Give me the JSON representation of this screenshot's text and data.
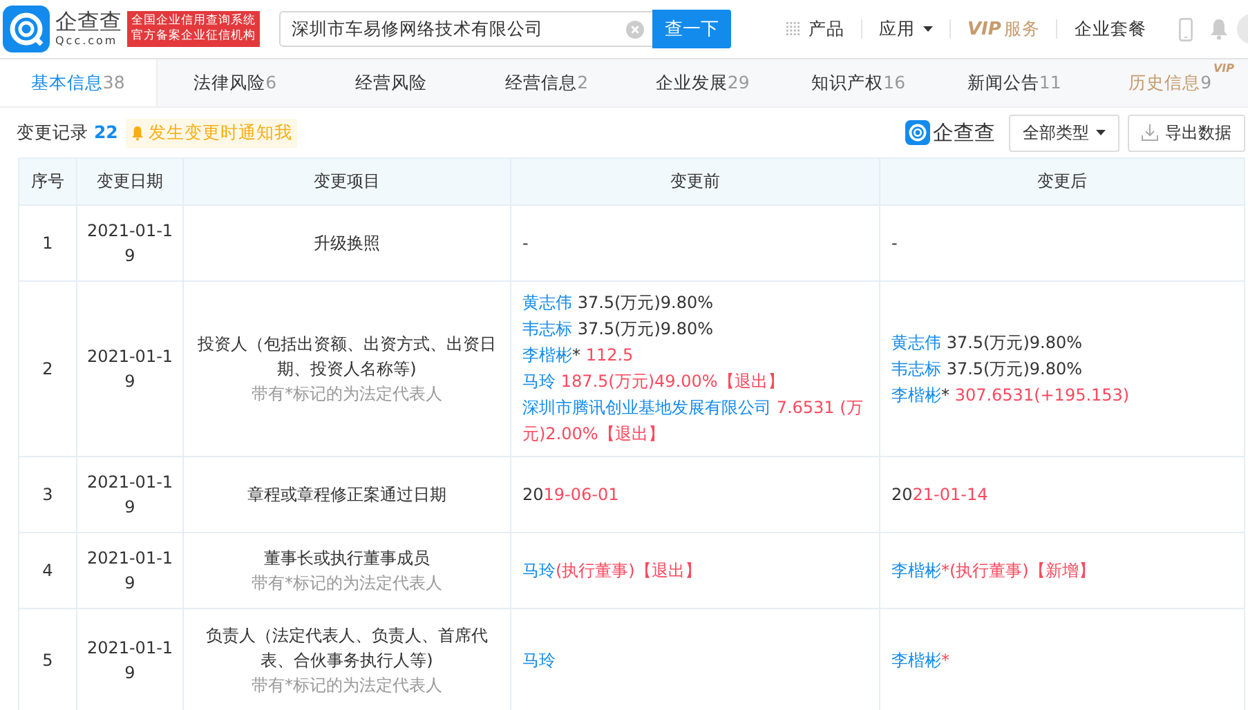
{
  "header": {
    "logo_name": "企查查",
    "logo_domain": "Qcc.com",
    "badge_lines": [
      "全国企业信用查询系统",
      "官方备案企业征信机构"
    ],
    "search": {
      "value": "深圳市车易修网络技术有限公司"
    },
    "search_button": "查一下",
    "nav": [
      {
        "kind": "grid",
        "label": "产品"
      },
      {
        "kind": "dropdown",
        "label": "应用"
      },
      {
        "kind": "vip",
        "label": "服务",
        "mark": "VIP"
      },
      {
        "kind": "plain",
        "label": "企业套餐"
      }
    ]
  },
  "tabs": [
    {
      "label": "基本信息",
      "count": "38",
      "selected": true,
      "kind": "normal"
    },
    {
      "label": "法律风险",
      "count": "6",
      "selected": false,
      "kind": "normal"
    },
    {
      "label": "经营风险",
      "selected": false,
      "kind": "normal"
    },
    {
      "label": "经营信息",
      "count": "2",
      "selected": false,
      "kind": "normal"
    },
    {
      "label": "企业发展",
      "count": "29",
      "selected": false,
      "kind": "normal"
    },
    {
      "label": "知识产权",
      "count": "16",
      "selected": false,
      "kind": "normal"
    },
    {
      "label": "新闻公告",
      "count": "11",
      "selected": false,
      "kind": "normal"
    },
    {
      "label": "历史信息",
      "count": "9",
      "selected": false,
      "kind": "vip",
      "badge": "VIP"
    }
  ],
  "toolbar": {
    "title": "变更记录",
    "count": "22",
    "notify": "发生变更时通知我",
    "brand": "企查查",
    "filter": "全部类型",
    "export": "导出数据"
  },
  "table": {
    "columns": [
      "序号",
      "变更日期",
      "变更项目",
      "变更前",
      "变更后"
    ],
    "rows": [
      {
        "index": "1",
        "date": "2021-01-19",
        "item": "升级换照",
        "note": null,
        "before": [
          [
            {
              "kind": "plain",
              "text": "-"
            }
          ]
        ],
        "after": [
          [
            {
              "kind": "plain",
              "text": "-"
            }
          ]
        ]
      },
      {
        "index": "2",
        "date": "2021-01-19",
        "item": "投资人（包括出资额、出资方式、出资日期、投资人名称等)",
        "note": "带有*标记的为法定代表人",
        "before": [
          [
            {
              "kind": "name",
              "text": "黄志伟"
            },
            {
              "kind": "plain",
              "text": " 37.5(万元)9.80%"
            }
          ],
          [
            {
              "kind": "name",
              "text": "韦志标"
            },
            {
              "kind": "plain",
              "text": " 37.5(万元)9.80%"
            }
          ],
          [
            {
              "kind": "name",
              "text": "李楷彬"
            },
            {
              "kind": "plain",
              "text": "*"
            },
            {
              "kind": "changed",
              "text": " 112.5"
            }
          ],
          [
            {
              "kind": "name",
              "text": "马玲"
            },
            {
              "kind": "changed",
              "text": " 187.5(万元)49.00%【退出】"
            }
          ],
          [
            {
              "kind": "name",
              "text": "深圳市腾讯创业基地发展有限公司"
            },
            {
              "kind": "changed",
              "text": " 7.6531 (万元)2.00%【退出】"
            }
          ]
        ],
        "after": [
          [
            {
              "kind": "name",
              "text": "黄志伟"
            },
            {
              "kind": "plain",
              "text": " 37.5(万元)9.80%"
            }
          ],
          [
            {
              "kind": "name",
              "text": "韦志标"
            },
            {
              "kind": "plain",
              "text": " 37.5(万元)9.80%"
            }
          ],
          [
            {
              "kind": "name",
              "text": "李楷彬"
            },
            {
              "kind": "plain",
              "text": "*"
            },
            {
              "kind": "changed",
              "text": " 307.6531(+195.153)"
            }
          ]
        ]
      },
      {
        "index": "3",
        "date": "2021-01-19",
        "item": "章程或章程修正案通过日期",
        "note": null,
        "before": [
          [
            {
              "kind": "plain",
              "text": "20"
            },
            {
              "kind": "changed",
              "text": "19-06-01"
            }
          ]
        ],
        "after": [
          [
            {
              "kind": "plain",
              "text": "20"
            },
            {
              "kind": "changed",
              "text": "21-01-14"
            }
          ]
        ]
      },
      {
        "index": "4",
        "date": "2021-01-19",
        "item": "董事长或执行董事成员",
        "note": "带有*标记的为法定代表人",
        "before": [
          [
            {
              "kind": "name",
              "text": "马玲"
            },
            {
              "kind": "changed",
              "text": "(执行董事)【退出】"
            }
          ]
        ],
        "after": [
          [
            {
              "kind": "name",
              "text": "李楷彬"
            },
            {
              "kind": "changed",
              "text": "*(执行董事)【新增】"
            }
          ]
        ]
      },
      {
        "index": "5",
        "date": "2021-01-19",
        "item": "负责人（法定代表人、负责人、首席代表、合伙事务执行人等)",
        "note": "带有*标记的为法定代表人",
        "before": [
          [
            {
              "kind": "name",
              "text": "马玲"
            }
          ]
        ],
        "after": [
          [
            {
              "kind": "name",
              "text": "李楷彬"
            },
            {
              "kind": "changed",
              "text": "*"
            }
          ]
        ]
      }
    ]
  }
}
